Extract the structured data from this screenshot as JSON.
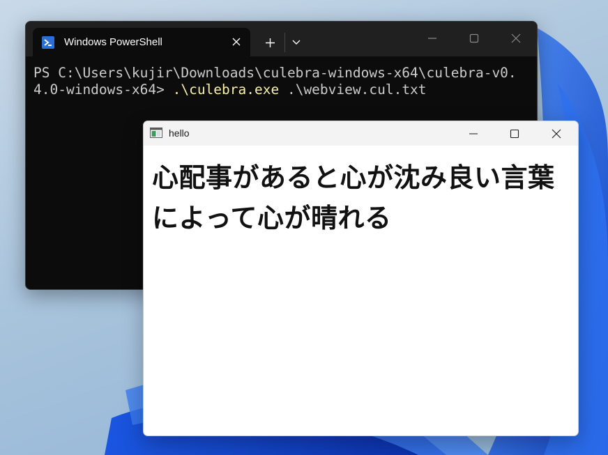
{
  "terminal": {
    "tab_title": "Windows PowerShell",
    "prompt": "PS C:\\Users\\kujir\\Downloads\\culebra-windows-x64\\culebra-v0.4.0-windows-x64> ",
    "command_exe": ".\\culebra.exe",
    "command_args": " .\\webview.cul.txt"
  },
  "hello_window": {
    "title": "hello",
    "body_text": "心配事があると心が沈み良い言葉によって心が晴れる"
  },
  "colors": {
    "terminal_bg": "#0c0c0c",
    "titlebar_bg": "#202020",
    "command_highlight": "#f9f1a5",
    "powershell_icon": "#2a6fd6"
  }
}
